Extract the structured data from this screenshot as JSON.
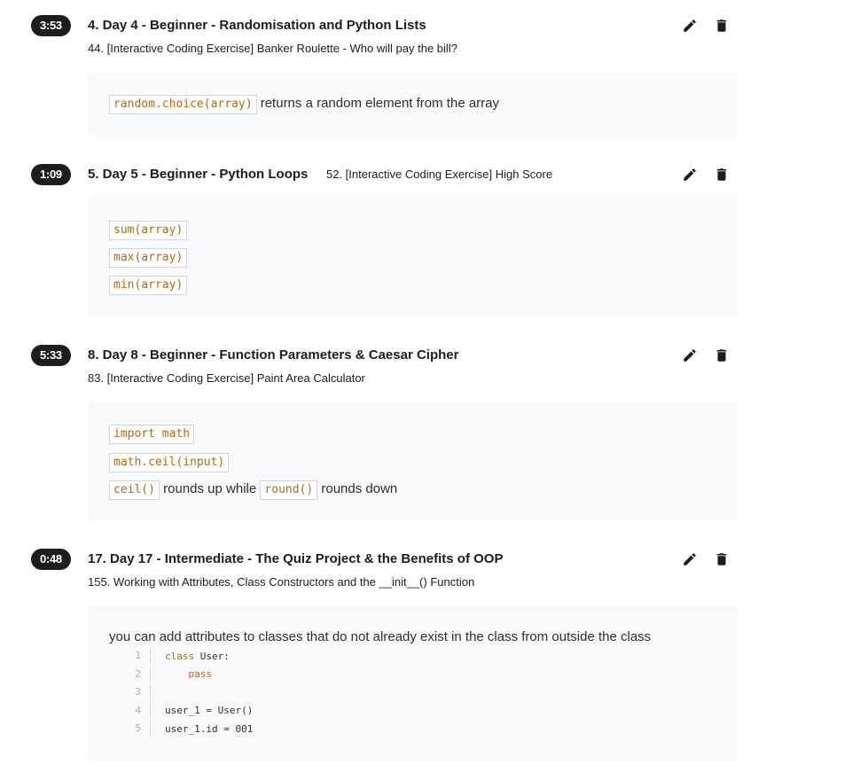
{
  "notes": [
    {
      "timestamp": "3:53",
      "section": "4. Day 4 - Beginner - Randomisation and Python Lists",
      "lecture": "44. [Interactive Coding Exercise] Banker Roulette - Who will pay the bill?",
      "lines": [
        {
          "code": "random.choice(array)",
          "text": "returns a random element from the array"
        }
      ]
    },
    {
      "timestamp": "1:09",
      "section": "5. Day 5 - Beginner - Python Loops",
      "lecture": "52. [Interactive Coding Exercise] High Score",
      "lines": [
        {
          "code": "sum(array)"
        },
        {
          "code": "max(array)"
        },
        {
          "code": "min(array)"
        }
      ]
    },
    {
      "timestamp": "5:33",
      "section": "8. Day 8 - Beginner - Function Parameters & Caesar Cipher",
      "lecture": "83. [Interactive Coding Exercise] Paint Area Calculator",
      "lines": [
        {
          "code": "import math"
        },
        {
          "code": "math.ceil(input)"
        },
        {
          "code": "ceil()",
          "text": "rounds up while",
          "code2": "round()",
          "text2": "rounds down"
        }
      ]
    },
    {
      "timestamp": "0:48",
      "section": "17. Day 17 - Intermediate - The Quiz Project & the Benefits of OOP",
      "lecture": "155. Working with Attributes, Class Constructors and the __init__() Function",
      "text": "you can add attributes to classes that do not already exist in the class from outside the class",
      "code_lines": [
        {
          "n": "1",
          "kw": "class",
          "rest": " User:"
        },
        {
          "n": "2",
          "kw": "    pass",
          "rest": ""
        },
        {
          "n": "3",
          "kw": "",
          "rest": ""
        },
        {
          "n": "4",
          "kw": "",
          "rest": "user_1 = User()"
        },
        {
          "n": "5",
          "kw": "",
          "rest": "user_1.id = 001"
        }
      ]
    }
  ],
  "icons": {
    "edit": "pencil-icon",
    "delete": "trash-icon"
  }
}
